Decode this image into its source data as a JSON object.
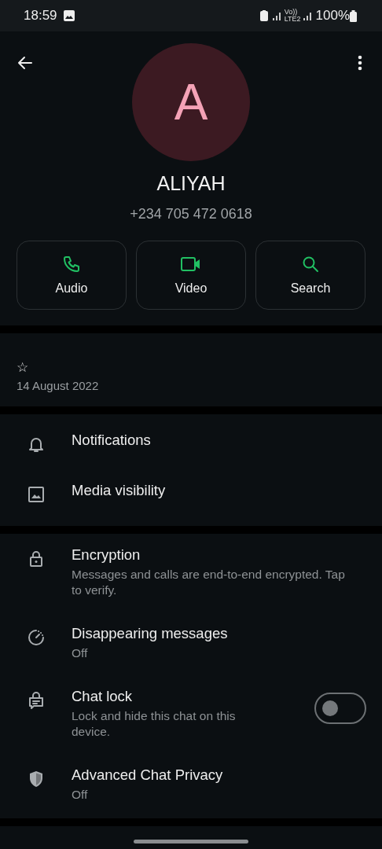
{
  "status_bar": {
    "time": "18:59",
    "network_labels": [
      "Vo))",
      "LTE2"
    ],
    "battery": "100%"
  },
  "contact": {
    "avatar_letter": "A",
    "name": "ALIYAH",
    "phone": "+234 705 472 0618"
  },
  "actions": [
    {
      "kind": "audio",
      "label": "Audio"
    },
    {
      "kind": "video",
      "label": "Video"
    },
    {
      "kind": "search",
      "label": "Search"
    }
  ],
  "about": {
    "star": "☆",
    "date": "14 August 2022"
  },
  "media_settings": [
    {
      "kind": "bell",
      "title": "Notifications"
    },
    {
      "kind": "image",
      "title": "Media visibility"
    }
  ],
  "privacy_settings": [
    {
      "kind": "lock",
      "title": "Encryption",
      "subtitle": "Messages and calls are end-to-end encrypted. Tap to verify."
    },
    {
      "kind": "timer",
      "title": "Disappearing messages",
      "subtitle": "Off"
    },
    {
      "kind": "chatlock",
      "title": "Chat lock",
      "subtitle": "Lock and hide this chat on this device.",
      "on": false
    },
    {
      "kind": "shield",
      "title": "Advanced Chat Privacy",
      "subtitle": "Off"
    }
  ]
}
